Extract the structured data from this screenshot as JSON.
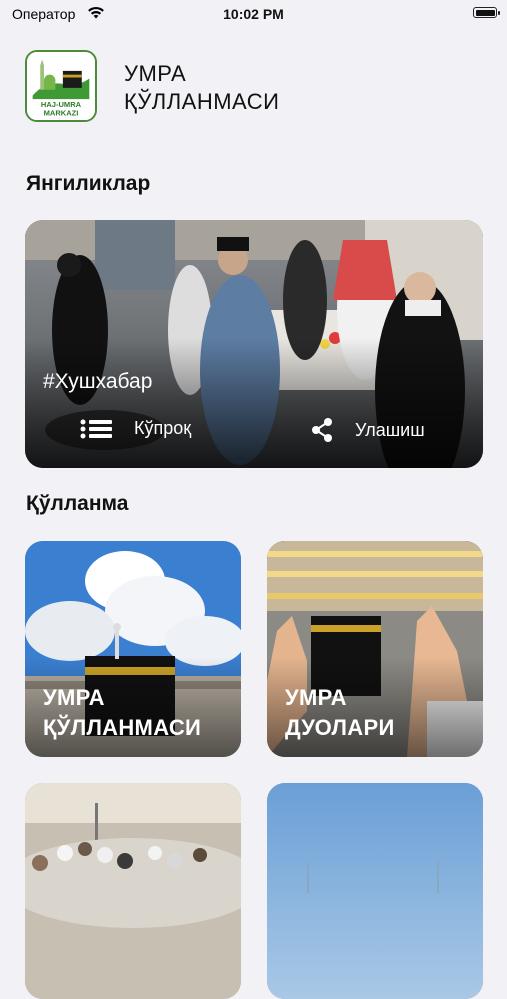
{
  "status_bar": {
    "carrier": "Оператор",
    "time": "10:02 PM"
  },
  "header": {
    "logo_text": [
      "HAJ-UMRA",
      "MARKAZI"
    ],
    "title_line1": "УМРА",
    "title_line2": "ҚЎЛЛАНМАСИ"
  },
  "news": {
    "section_title": "Янгиликлар",
    "card": {
      "tag": "#Хушхабар",
      "more_label": "Кўпроқ",
      "share_label": "Улашиш"
    }
  },
  "guide": {
    "section_title": "Қўлланма",
    "tiles": [
      {
        "line1": "УМРА",
        "line2": "ҚЎЛЛАНМАСИ"
      },
      {
        "line1": "УМРА",
        "line2": "ДУОЛАРИ"
      },
      {
        "line1": "",
        "line2": ""
      },
      {
        "line1": "",
        "line2": ""
      }
    ]
  }
}
